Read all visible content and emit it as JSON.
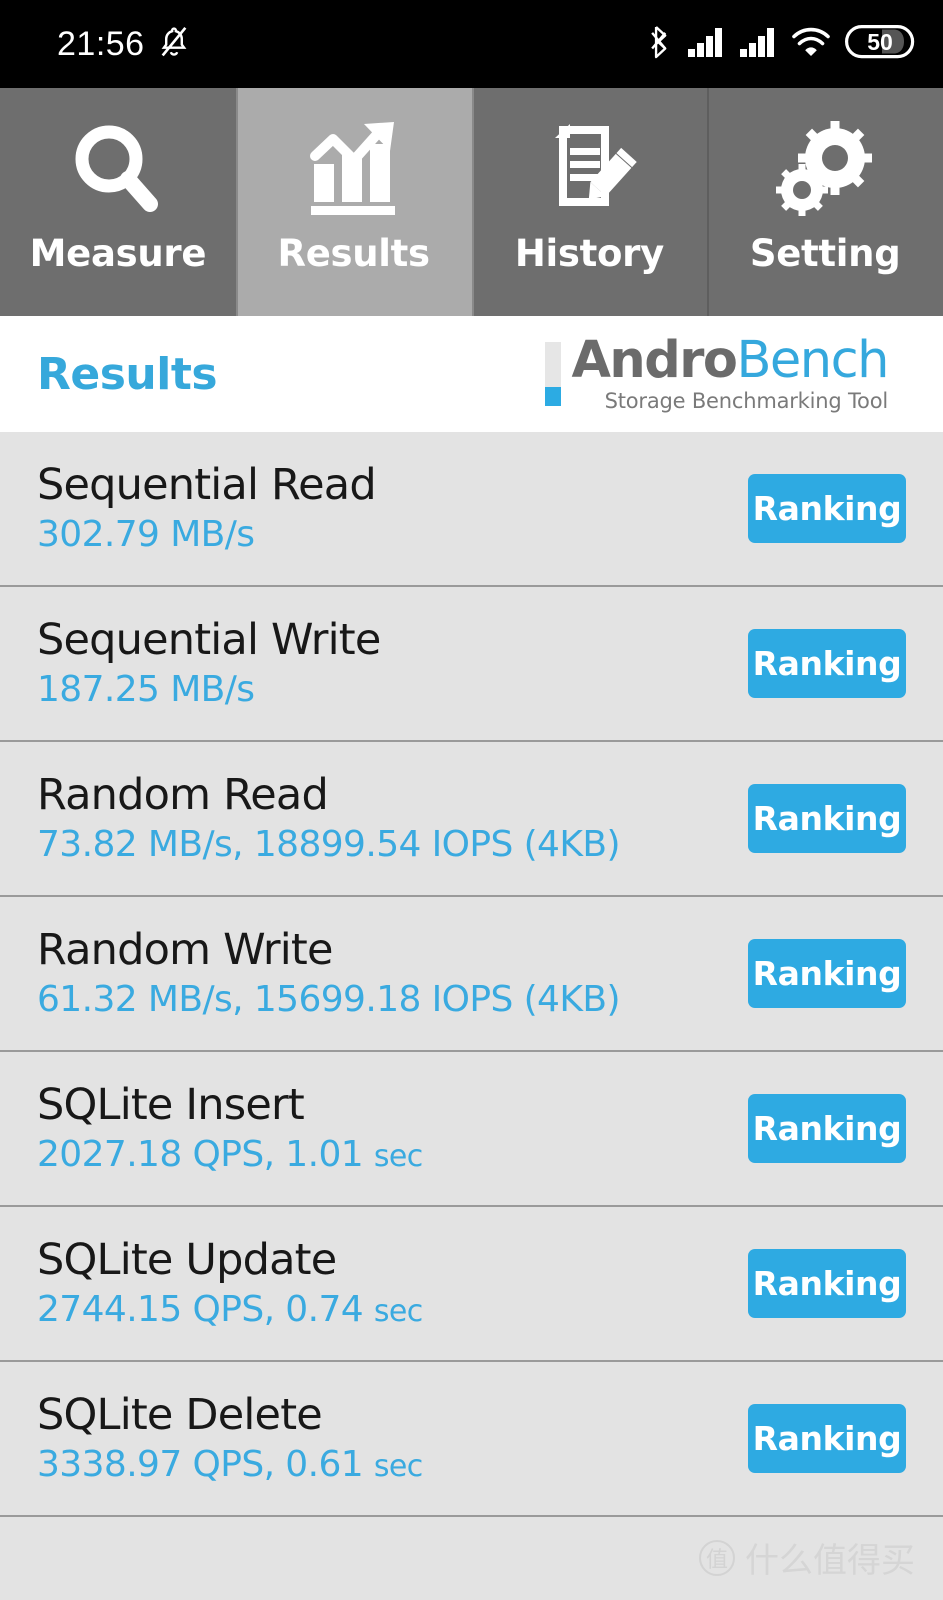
{
  "statusbar": {
    "time": "21:56",
    "icons": [
      "bell-mute-icon",
      "bluetooth-icon",
      "signal-bars-icon",
      "signal-bars-2-icon",
      "wifi-icon",
      "battery-icon"
    ],
    "battery_level": "50"
  },
  "tabs": [
    {
      "label": "Measure",
      "icon": "magnifier-icon",
      "active": false
    },
    {
      "label": "Results",
      "icon": "bar-chart-arrow-icon",
      "active": true
    },
    {
      "label": "History",
      "icon": "document-pencil-icon",
      "active": false
    },
    {
      "label": "Setting",
      "icon": "gears-icon",
      "active": false
    }
  ],
  "header": {
    "title": "Results",
    "brand_primary": "Andro",
    "brand_secondary": "Bench",
    "brand_tagline": "Storage Benchmarking Tool"
  },
  "results": [
    {
      "name": "Sequential Read",
      "value": "302.79 MB/s",
      "value_suffix": "",
      "button": "Ranking"
    },
    {
      "name": "Sequential Write",
      "value": "187.25 MB/s",
      "value_suffix": "",
      "button": "Ranking"
    },
    {
      "name": "Random Read",
      "value": "73.82 MB/s, 18899.54 IOPS (4KB)",
      "value_suffix": "",
      "button": "Ranking"
    },
    {
      "name": "Random Write",
      "value": "61.32 MB/s, 15699.18 IOPS (4KB)",
      "value_suffix": "",
      "button": "Ranking"
    },
    {
      "name": "SQLite Insert",
      "value": "2027.18 QPS, 1.01 ",
      "value_suffix": "sec",
      "button": "Ranking"
    },
    {
      "name": "SQLite Update",
      "value": "2744.15 QPS, 0.74 ",
      "value_suffix": "sec",
      "button": "Ranking"
    },
    {
      "name": "SQLite Delete",
      "value": "3338.97 QPS, 0.61 ",
      "value_suffix": "sec",
      "button": "Ranking"
    }
  ],
  "watermark": {
    "badge": "值",
    "text": "什么值得买"
  },
  "colors": {
    "accent_blue": "#2eaae2",
    "title_blue": "#36a8db",
    "value_blue": "#3aaae0",
    "list_bg": "#e3e3e3",
    "tab_bg": "#6e6e6e",
    "tab_active_bg": "#ababab",
    "statusbar_bg": "#000000"
  }
}
